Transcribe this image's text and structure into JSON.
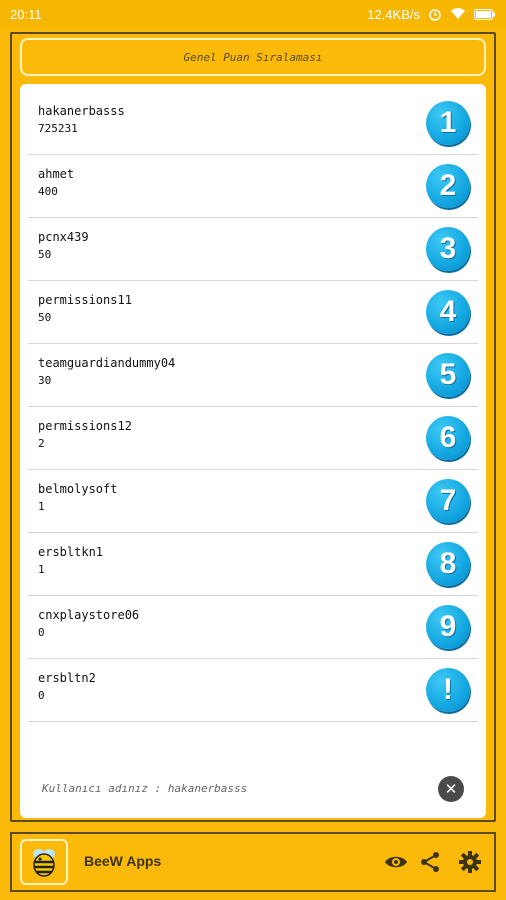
{
  "status_bar": {
    "time": "20:11",
    "network_speed": "12,4KB/s"
  },
  "header": {
    "title": "Genel Puan Sıralaması"
  },
  "leaderboard": [
    {
      "rank": "1",
      "name": "hakanerbasss",
      "score": "725231"
    },
    {
      "rank": "2",
      "name": "ahmet",
      "score": "400"
    },
    {
      "rank": "3",
      "name": "pcnx439",
      "score": "50"
    },
    {
      "rank": "4",
      "name": "permissions11",
      "score": "50"
    },
    {
      "rank": "5",
      "name": "teamguardiandummy04",
      "score": "30"
    },
    {
      "rank": "6",
      "name": "permissions12",
      "score": "2"
    },
    {
      "rank": "7",
      "name": "belmolysoft",
      "score": "1"
    },
    {
      "rank": "8",
      "name": "ersbltkn1",
      "score": "1"
    },
    {
      "rank": "9",
      "name": "cnxplaystore06",
      "score": "0"
    },
    {
      "rank": "!",
      "name": "ersbltn2",
      "score": "0"
    }
  ],
  "footer": {
    "username_line": "Kullanıcı adınız : hakanerbasss"
  },
  "bottom_bar": {
    "app_name": "BeeW Apps",
    "icons": [
      "eye-icon",
      "share-icon",
      "gear-icon"
    ]
  },
  "colors": {
    "accent": "#fbba0a",
    "badge": "#12a6e0",
    "dark": "#5b4a2a"
  }
}
